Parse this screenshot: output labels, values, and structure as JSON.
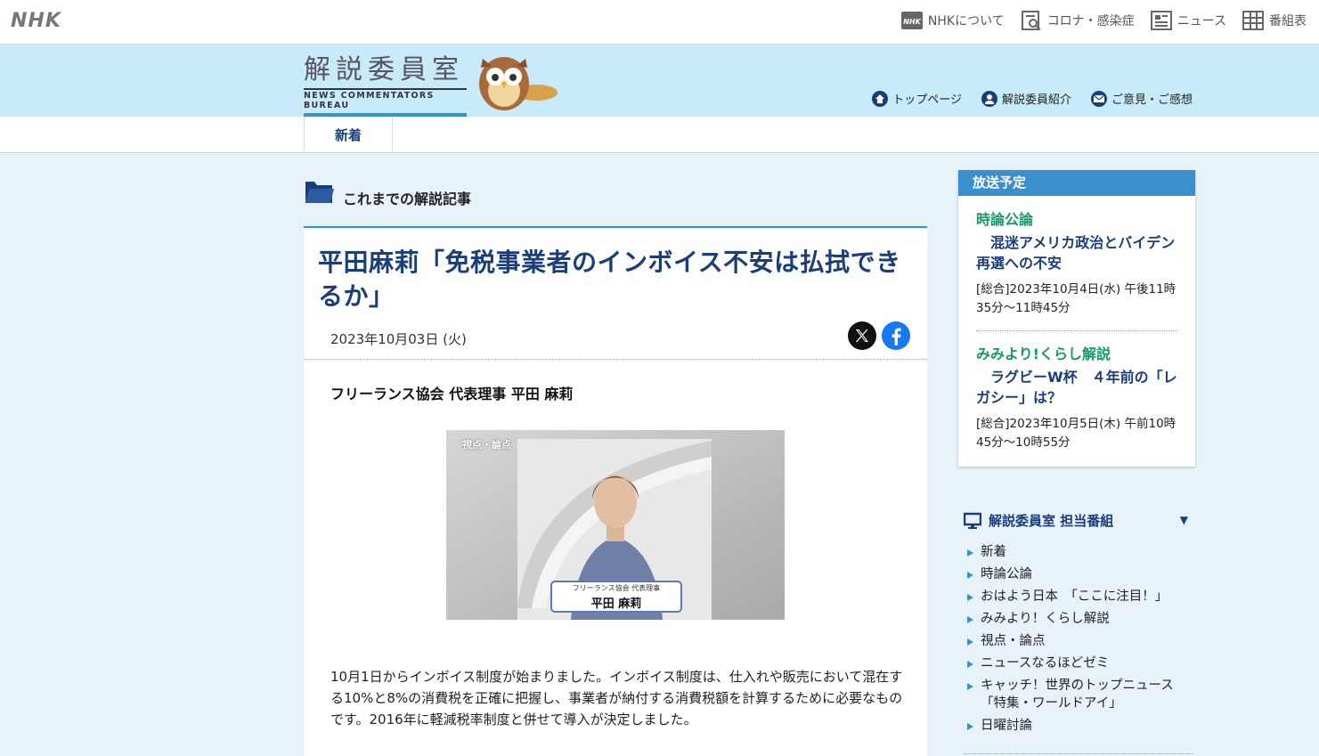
{
  "global": {
    "logo": "NHK",
    "nav": [
      {
        "label": "NHKについて",
        "icon": "nhk-box-icon"
      },
      {
        "label": "コロナ・感染症",
        "icon": "virus-doc-icon"
      },
      {
        "label": "ニュース",
        "icon": "news-icon"
      },
      {
        "label": "番組表",
        "icon": "grid-icon"
      }
    ]
  },
  "header": {
    "title_jp": "解説委員室",
    "title_en": "NEWS COMMENTATORS BUREAU",
    "nav": [
      {
        "label": "トップページ",
        "icon": "home-icon"
      },
      {
        "label": "解説委員紹介",
        "icon": "person-icon"
      },
      {
        "label": "ご意見・ご感想",
        "icon": "mail-icon"
      }
    ]
  },
  "tabs": {
    "new": "新着"
  },
  "main": {
    "section_heading": "これまでの解説記事",
    "article": {
      "title": "平田麻莉「免税事業者のインボイス不安は払拭できるか」",
      "date": "2023年10月03日 (火)",
      "byline": "フリーランス協会 代表理事 平田 麻莉",
      "photo": {
        "corner_label": "視点・論点",
        "caption_small": "フリーランス協会 代表理事",
        "caption_name": "平田 麻莉"
      },
      "body": "10月1日からインボイス制度が始まりました。インボイス制度は、仕入れや販売において混在する10%と8%の消費税を正確に把握し、事業者が納付する消費税額を計算するために必要なものです。2016年に軽減税率制度と併せて導入が決定しました。"
    }
  },
  "sidebar": {
    "schedule": {
      "heading": "放送予定",
      "items": [
        {
          "program": "時論公論",
          "title": "混迷アメリカ政治とバイデン再選への不安",
          "time": "[総合]2023年10月4日(水) 午後11時35分～11時45分"
        },
        {
          "program": "みみより!くらし解説",
          "title": "ラグビーW杯　４年前の「レガシー」は？",
          "time": "[総合]2023年10月5日(木) 午前10時45分～10時55分"
        }
      ]
    },
    "programs": {
      "heading": "解説委員室 担当番組",
      "items": [
        "新着",
        "時論公論",
        "おはよう日本　「ここに注目！」",
        "みみより！くらし解説",
        "視点・論点",
        "ニュースなるほどゼミ",
        "キャッチ！世界のトップニュース「特集・ワールドアイ」",
        "日曜討論"
      ]
    }
  },
  "colors": {
    "brand_blue": "#1b3e7a",
    "accent_blue": "#3a8fcf",
    "header_bg": "#c8ebfa",
    "page_bg": "#e8f3f9",
    "program_green": "#13996a"
  }
}
